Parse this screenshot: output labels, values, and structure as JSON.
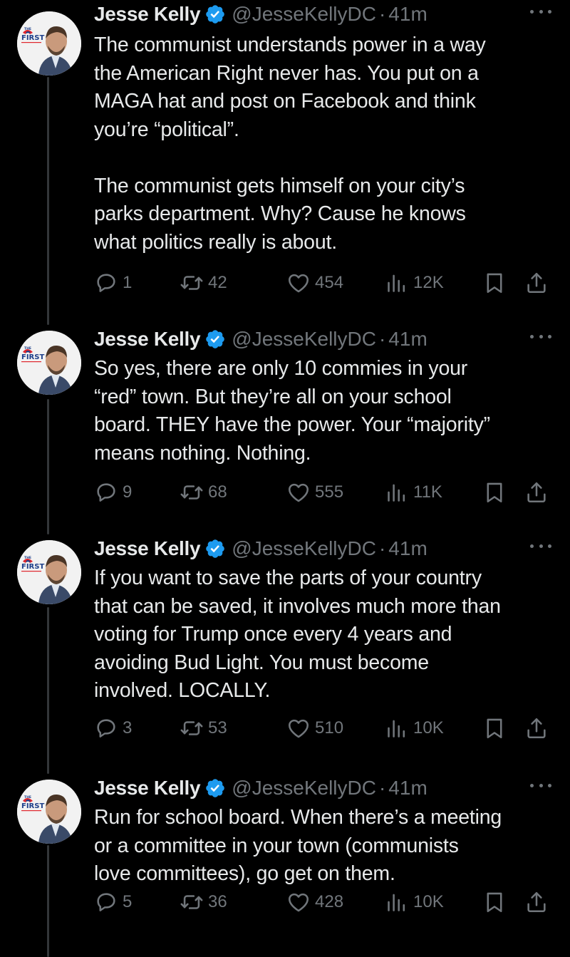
{
  "author": {
    "name": "Jesse Kelly",
    "handle": "@JesseKellyDC",
    "separator": "·",
    "avatar_badge_small": "THE",
    "avatar_badge_big": "FIRST"
  },
  "colors": {
    "background": "#000000",
    "text": "#e7e9ea",
    "muted": "#71767b",
    "verified": "#1d9bf0",
    "thread_line": "#333639"
  },
  "icons": [
    "reply-icon",
    "retweet-icon",
    "like-icon",
    "views-icon",
    "bookmark-icon",
    "share-icon",
    "verified-badge-icon",
    "more-icon"
  ],
  "tweets": [
    {
      "time": "41m",
      "text": "The communist understands power in a way\nthe American Right never has. You put on a\nMAGA hat and post on Facebook and think\nyou’re “political”.\n\nThe communist gets himself on your city’s\nparks department. Why? Cause he knows\nwhat politics really is about.",
      "replies": "1",
      "retweets": "42",
      "likes": "454",
      "views": "12K"
    },
    {
      "time": "41m",
      "text": "So yes, there are only 10 commies in your\n“red” town. But they’re all on your school\nboard. THEY have the power. Your “majority”\nmeans nothing. Nothing.",
      "replies": "9",
      "retweets": "68",
      "likes": "555",
      "views": "11K"
    },
    {
      "time": "41m",
      "text": "If you want to save the parts of your country\nthat can be saved, it involves much more than\nvoting for Trump once every 4 years and\navoiding Bud Light. You must become\ninvolved. LOCALLY.",
      "replies": "3",
      "retweets": "53",
      "likes": "510",
      "views": "10K"
    },
    {
      "time": "41m",
      "text": "Run for school board. When there’s a meeting\nor a committee in your town (communists\nlove committees), go get on them.",
      "replies": "5",
      "retweets": "36",
      "likes": "428",
      "views": "10K"
    }
  ]
}
